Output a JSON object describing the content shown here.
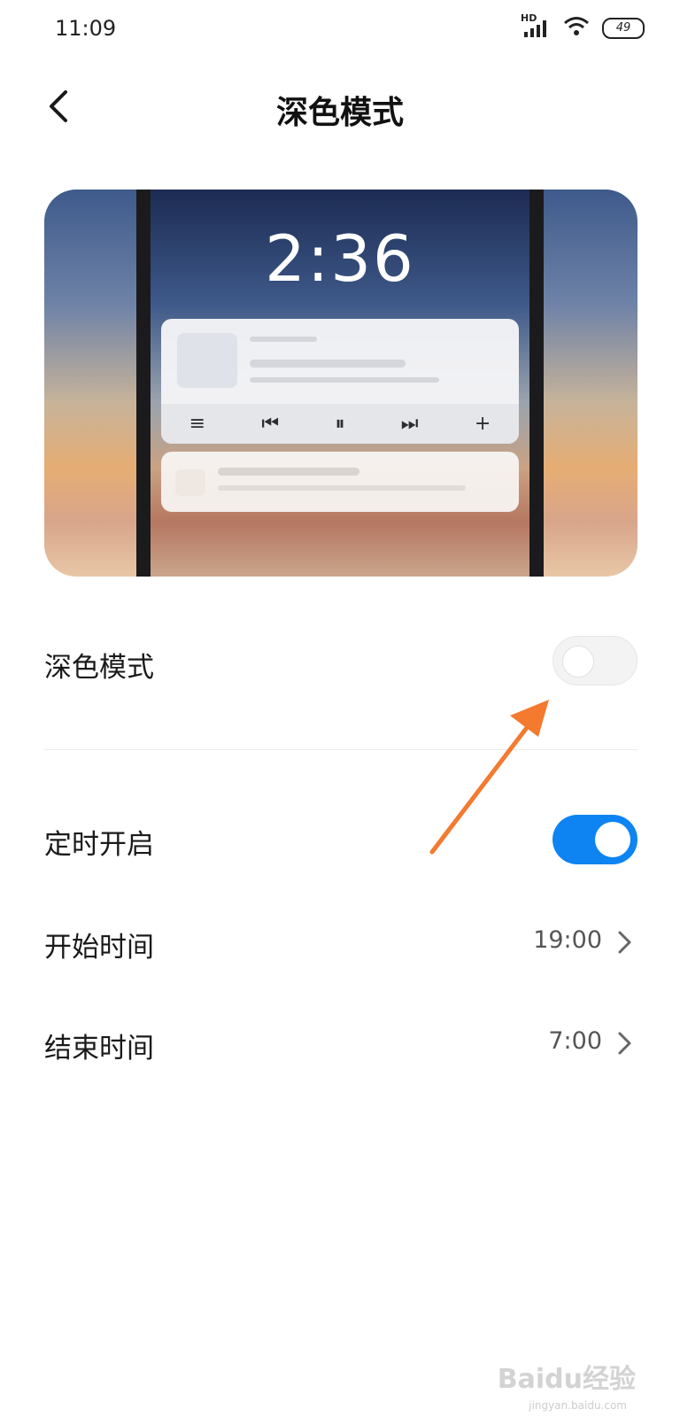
{
  "status_bar": {
    "time": "11:09",
    "network": "HD",
    "battery": "49"
  },
  "header": {
    "title": "深色模式"
  },
  "preview": {
    "clock": "2:36",
    "controls": {
      "menu": "≡",
      "prev": "⏮",
      "pause": "⏸",
      "next": "⏭",
      "add": "+"
    }
  },
  "settings": {
    "dark_mode": {
      "label": "深色模式",
      "enabled": false
    },
    "scheduled": {
      "label": "定时开启",
      "enabled": true
    },
    "start_time": {
      "label": "开始时间",
      "value": "19:00"
    },
    "end_time": {
      "label": "结束时间",
      "value": "7:00"
    }
  },
  "colors": {
    "accent": "#0D84F2",
    "annotation_arrow": "#F47A2F"
  },
  "watermark": {
    "text": "Baidu经验",
    "sub": "jingyan.baidu.com"
  }
}
